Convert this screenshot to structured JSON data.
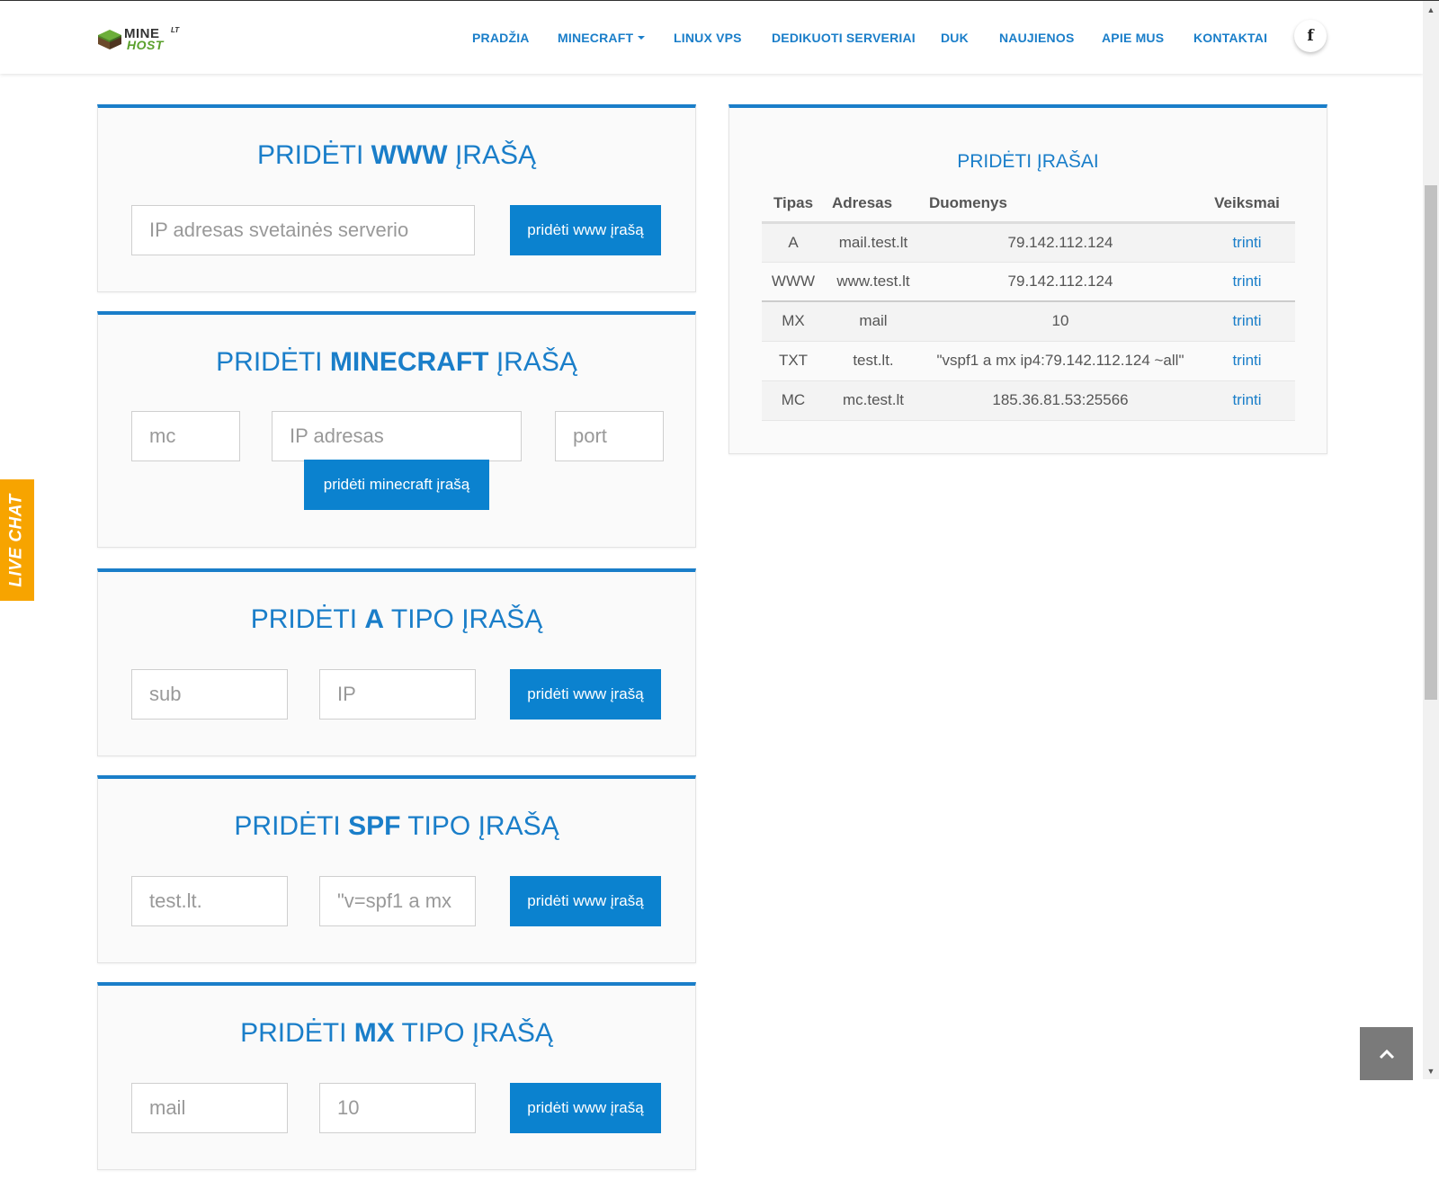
{
  "header": {
    "logo": {
      "main": "MINE",
      "sup": "LT",
      "sub": "HOST"
    },
    "nav": [
      "PRADŽIA",
      "MINECRAFT",
      "LINUX VPS",
      "DEDIKUOTI SERVERIAI",
      "DUK",
      "NAUJIENOS",
      "APIE MUS",
      "KONTAKTAI"
    ],
    "facebook_glyph": "f"
  },
  "live_chat": "LIVE CHAT",
  "forms": {
    "www": {
      "title_pre": "PRIDĖTI ",
      "title_bold": "WWW",
      "title_post": " ĮRAŠĄ",
      "ip_placeholder": "IP adresas svetainės serverio",
      "button": "pridėti www įrašą"
    },
    "minecraft": {
      "title_pre": "PRIDĖTI ",
      "title_bold": "MINECRAFT",
      "title_post": " ĮRAŠĄ",
      "sub_placeholder": "mc",
      "ip_placeholder": "IP adresas",
      "port_placeholder": "port",
      "button": "pridėti minecraft įrašą"
    },
    "a": {
      "title_pre": "PRIDĖTI ",
      "title_bold": "A",
      "title_post": " TIPO ĮRAŠĄ",
      "sub_placeholder": "sub",
      "ip_placeholder": "IP",
      "button": "pridėti www įrašą"
    },
    "spf": {
      "title_pre": "PRIDĖTI ",
      "title_bold": "SPF",
      "title_post": " TIPO ĮRAŠĄ",
      "host_placeholder": "test.lt.",
      "value_placeholder": "\"v=spf1 a mx",
      "button": "pridėti www įrašą"
    },
    "mx": {
      "title_pre": "PRIDĖTI ",
      "title_bold": "MX",
      "title_post": " TIPO ĮRAŠĄ",
      "host_placeholder": "mail",
      "priority_placeholder": "10",
      "button": "pridėti www įrašą"
    }
  },
  "records": {
    "title": "PRIDĖTI ĮRAŠAI",
    "columns": [
      "Tipas",
      "Adresas",
      "Duomenys",
      "Veiksmai"
    ],
    "rows": [
      {
        "type": "A",
        "address": "mail.test.lt",
        "data": "79.142.112.124",
        "action": "trinti"
      },
      {
        "type": "WWW",
        "address": "www.test.lt",
        "data": "79.142.112.124",
        "action": "trinti"
      },
      {
        "type": "MX",
        "address": "mail",
        "data": "10",
        "action": "trinti"
      },
      {
        "type": "TXT",
        "address": "test.lt.",
        "data": "\"vspf1 a mx ip4:79.142.112.124 ~all\"",
        "action": "trinti"
      },
      {
        "type": "MC",
        "address": "mc.test.lt",
        "data": "185.36.81.53:25566",
        "action": "trinti"
      }
    ]
  },
  "colors": {
    "accent": "#1a7ec9",
    "button": "#0b82cf",
    "live_chat": "#f7a400",
    "logo_green": "#5aa02c"
  }
}
